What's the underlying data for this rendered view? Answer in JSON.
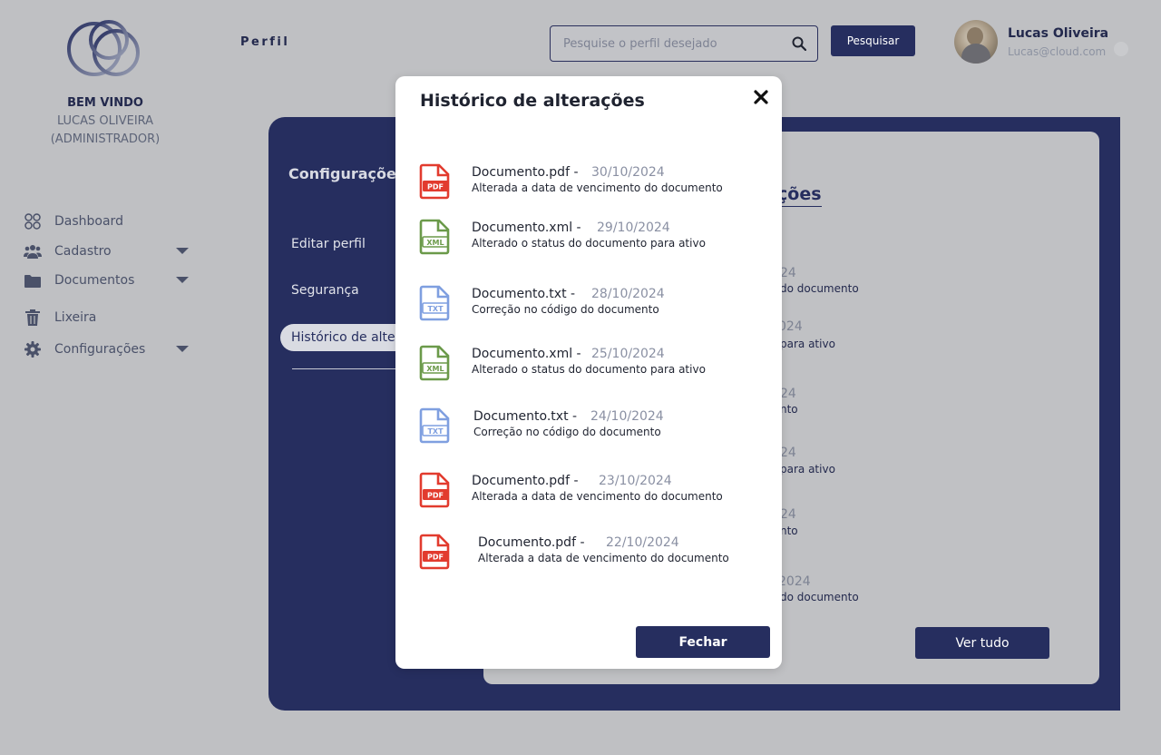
{
  "sidebar": {
    "welcome_line1": "BEM VINDO",
    "welcome_line2": "LUCAS OLIVEIRA",
    "welcome_line3": "(ADMINISTRADOR)",
    "items": [
      {
        "label": "Dashboard",
        "icon": "dashboard-icon"
      },
      {
        "label": "Cadastro",
        "icon": "users-icon"
      },
      {
        "label": "Documentos",
        "icon": "folder-icon"
      },
      {
        "label": "Lixeira",
        "icon": "trash-icon"
      },
      {
        "label": "Configurações",
        "icon": "gear-icon"
      }
    ]
  },
  "header": {
    "title": "Perfil",
    "search_placeholder": "Pesquise o perfil desejado",
    "search_button": "Pesquisar",
    "user_name": "Lucas Oliveira",
    "user_email": "Lucas@cloud.com"
  },
  "settings": {
    "heading": "Configurações",
    "links": [
      "Editar perfil",
      "Segurança",
      "Histórico de alte"
    ]
  },
  "background_card": {
    "title_fragment": "ções",
    "rows": [
      {
        "date": "24",
        "desc": "do documento"
      },
      {
        "date": "024",
        "desc": "para ativo"
      },
      {
        "date": "24",
        "desc": "nto"
      },
      {
        "date": "24",
        "desc": "para ativo"
      },
      {
        "date": "24",
        "desc": "nto"
      },
      {
        "date": "2024",
        "desc": "do documento"
      }
    ],
    "see_all_button": "Ver tudo"
  },
  "modal": {
    "title": "Histórico de alterações",
    "close_button": "Fechar",
    "items": [
      {
        "type": "PDF",
        "name": "Documento.pdf -",
        "date": "30/10/2024",
        "desc": "Alterada a data de vencimento do documento"
      },
      {
        "type": "XML",
        "name": "Documento.xml -",
        "date": "29/10/2024",
        "desc": "Alterado o status do documento para ativo"
      },
      {
        "type": "TXT",
        "name": "Documento.txt -",
        "date": "28/10/2024",
        "desc": "Correção no código do documento"
      },
      {
        "type": "XML",
        "name": "Documento.xml -",
        "date": "25/10/2024",
        "desc": "Alterado o status do documento para ativo"
      },
      {
        "type": "TXT",
        "name": "Documento.txt -",
        "date": "24/10/2024",
        "desc": "Correção no código do documento"
      },
      {
        "type": "PDF",
        "name": "Documento.pdf -",
        "date": "23/10/2024",
        "desc": "Alterada a data de vencimento do documento"
      },
      {
        "type": "PDF",
        "name": "Documento.pdf -",
        "date": "22/10/2024",
        "desc": "Alterada a data de vencimento do documento"
      }
    ]
  },
  "colors": {
    "brand_navy": "#262e5f",
    "pdf_red": "#e23b2e",
    "xml_green": "#6b9a4a",
    "txt_blue": "#7f9fe0"
  }
}
